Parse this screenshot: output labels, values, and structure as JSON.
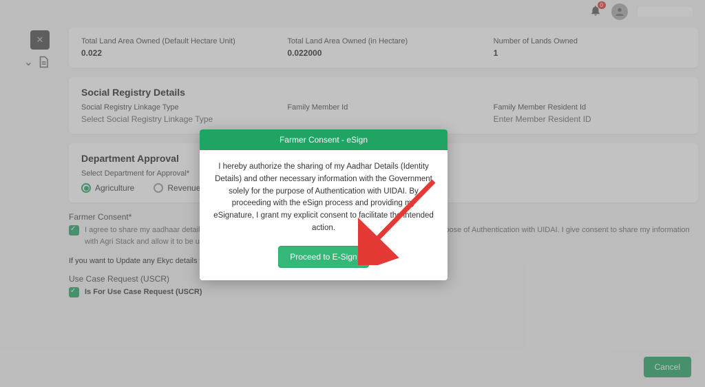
{
  "topbar": {
    "notification_count": "0"
  },
  "land_card": {
    "col1_label": "Total Land Area Owned (Default Hectare Unit)",
    "col1_value": "0.022",
    "col2_label": "Total Land Area Owned (in Hectare)",
    "col2_value": "0.022000",
    "col3_label": "Number of Lands Owned",
    "col3_value": "1"
  },
  "social": {
    "title": "Social Registry Details",
    "col1_label": "Social Registry Linkage Type",
    "col1_value": "Select Social Registry Linkage Type",
    "col2_label": "Family Member Id",
    "col3_label": "Family Member Resident Id",
    "col3_value": "Enter Member Resident ID"
  },
  "dept": {
    "title": "Department Approval",
    "subtitle": "Select Department for Approval*",
    "opt1": "Agriculture",
    "opt2": "Revenue"
  },
  "consent": {
    "label": "Farmer Consent*",
    "text": "I agree to share my aadhaar details (Identity Information) and other information with Government for the purpose of Authentication with UIDAI. I give consent to share my information with Agri Stack and allow it to be used by welfare schemes of various departments of government",
    "update_prefix": "If you want to Update any Ekyc details then click on ",
    "update_link": "Update"
  },
  "uscr": {
    "label": "Use Case Request (USCR)",
    "text": "Is For Use Case Request (USCR)"
  },
  "cancel": "Cancel",
  "modal": {
    "title": "Farmer Consent - eSign",
    "body": "I hereby authorize the sharing of my Aadhar Details (Identity Details) and other necessary information with the Government solely for the purpose of Authentication with UIDAI. By proceeding with the eSign process and providing my eSignature, I grant my explicit consent to facilitate the intended action.",
    "button": "Proceed to E-Sign"
  }
}
